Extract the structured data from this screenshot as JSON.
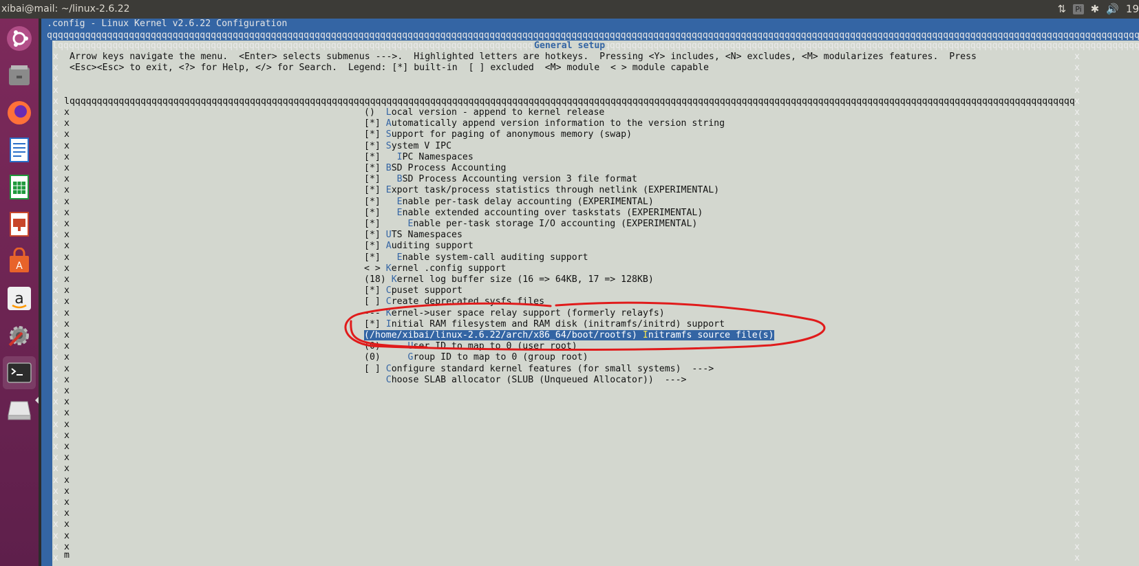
{
  "topbar": {
    "window_title": "xibai@mail: ~/linux-2.6.22",
    "indicators": [
      "⇅",
      "Pi",
      "✱",
      "🔊",
      "19"
    ]
  },
  "launcher": {
    "apps": [
      {
        "name": "ubuntu-dash-icon",
        "color": "#e95420"
      },
      {
        "name": "files-icon",
        "color": "#8a8a8a"
      },
      {
        "name": "firefox-icon",
        "color": "#ff7139"
      },
      {
        "name": "writer-icon",
        "color": "#2a6fc9"
      },
      {
        "name": "calc-icon",
        "color": "#1f9a3c"
      },
      {
        "name": "impress-icon",
        "color": "#c8462a"
      },
      {
        "name": "software-center-icon",
        "color": "#e8632a"
      },
      {
        "name": "amazon-icon",
        "color": "#333333"
      },
      {
        "name": "system-settings-icon",
        "color": "#777777"
      },
      {
        "name": "terminal-icon",
        "color": "#2c2c2c"
      },
      {
        "name": "drive-icon",
        "color": "#cfcfcf"
      }
    ]
  },
  "terminal": {
    "title_line": ".config - Linux Kernel v2.6.22 Configuration",
    "top_border": "qqqqqqqqqqqqqqqqqqqqqqqqqqqqqqqqqqqqqqqqqqqqqqqqqqqqqqqqqqqqqqqqqqqqqqqqqqqqqqqqqqqqqqqqqqqqqqqqqqqqqqqqqqqqqqqqqqqqqqqqqqqqqqqqqqqqqqqqqqqqqqqqqqqqqqqqqqqqqqqqqqqqqqqqqqqqqqqqqqqqqqqqqqqqqqqqqqqqqqqqqq"
  },
  "dialog": {
    "title": "General setup",
    "top_border": "lqqqqqqqqqqqqqqqqqqqqqqqqqqqqqqqqqqqqqqqqqqqqqqqqqqqqqqqqqqqqqqqqqqqqqqqqqqqqqqqqqqqqqqqqqqqqqqqqqqqqqqqqqqqqqqqqqqqqqqqqqqqqqqqqqqqqqqqqqqqqqqqqqqqqqqqqqqqqqqqqqqqqqqqqqqqqqqqqqqqqqqqqqqqqqqqqqqqqqqqqq",
    "help_line1": "Arrow keys navigate the menu.  <Enter> selects submenus --->.  Highlighted letters are hotkeys.  Pressing <Y> includes, <N> excludes, <M> modularizes features.  Press",
    "help_line2": "<Esc><Esc> to exit, <?> for Help, </> for Search.  Legend: [*] built-in  [ ] excluded  <M> module  < > module capable",
    "menu_border": "lqqqqqqqqqqqqqqqqqqqqqqqqqqqqqqqqqqqqqqqqqqqqqqqqqqqqqqqqqqqqqqqqqqqqqqqqqqqqqqqqqqqqqqqqqqqqqqqqqqqqqqqqqqqqqqqqqqqqqqqqqqqqqqqqqqqqqqqqqqqqqqqqqqqqqqqqqqqqqqqqqqqqqqqqqqqqqqqqqqqqqqqqqqqqqqqqqqqqqqqqqqqqqqqqqqqqqqqqqqqqqqqqqqqqqqqqqq",
    "border_char": "x",
    "bottom_mark": "m",
    "items": [
      {
        "prefix": "()  ",
        "hotkey": "L",
        "rest": "ocal version - append to kernel release"
      },
      {
        "prefix": "[*] ",
        "hotkey": "A",
        "rest": "utomatically append version information to the version string"
      },
      {
        "prefix": "[*] ",
        "hotkey": "S",
        "rest": "upport for paging of anonymous memory (swap)"
      },
      {
        "prefix": "[*] ",
        "hotkey": "S",
        "rest": "ystem V IPC"
      },
      {
        "prefix": "[*]   ",
        "hotkey": "I",
        "rest": "PC Namespaces"
      },
      {
        "prefix": "[*] ",
        "hotkey": "B",
        "rest": "SD Process Accounting"
      },
      {
        "prefix": "[*]   ",
        "hotkey": "B",
        "rest": "SD Process Accounting version 3 file format"
      },
      {
        "prefix": "[*] ",
        "hotkey": "E",
        "rest": "xport task/process statistics through netlink (EXPERIMENTAL)"
      },
      {
        "prefix": "[*]   ",
        "hotkey": "E",
        "rest": "nable per-task delay accounting (EXPERIMENTAL)"
      },
      {
        "prefix": "[*]   ",
        "hotkey": "E",
        "rest": "nable extended accounting over taskstats (EXPERIMENTAL)"
      },
      {
        "prefix": "[*]     ",
        "hotkey": "E",
        "rest": "nable per-task storage I/O accounting (EXPERIMENTAL)"
      },
      {
        "prefix": "[*] ",
        "hotkey": "U",
        "rest": "TS Namespaces"
      },
      {
        "prefix": "[*] ",
        "hotkey": "A",
        "rest": "uditing support"
      },
      {
        "prefix": "[*]   ",
        "hotkey": "E",
        "rest": "nable system-call auditing support"
      },
      {
        "prefix": "< > ",
        "hotkey": "K",
        "rest": "ernel .config support"
      },
      {
        "prefix": "(18) ",
        "hotkey": "K",
        "rest": "ernel log buffer size (16 => 64KB, 17 => 128KB)"
      },
      {
        "prefix": "[*] ",
        "hotkey": "C",
        "rest": "puset support"
      },
      {
        "prefix": "[ ] ",
        "hotkey": "C",
        "rest": "reate deprecated sysfs files"
      },
      {
        "prefix": "--- ",
        "hotkey": "K",
        "rest": "ernel->user space relay support (formerly relayfs)"
      },
      {
        "prefix": "[*] ",
        "hotkey": "I",
        "rest": "nitial RAM filesystem and RAM disk (initramfs/initrd) support"
      },
      {
        "prefix": "(/home/xibai/linux-2.6.22/arch/x86_64/boot/rootfs) ",
        "hotkey": "I",
        "rest": "nitramfs source file(s)",
        "selected": true
      },
      {
        "prefix": "(0)     ",
        "hotkey": "U",
        "rest": "ser ID to map to 0 (user root)"
      },
      {
        "prefix": "(0)     ",
        "hotkey": "G",
        "rest": "roup ID to map to 0 (group root)"
      },
      {
        "prefix": "[ ] ",
        "hotkey": "C",
        "rest": "onfigure standard kernel features (for small systems)  --->"
      },
      {
        "prefix": "    ",
        "hotkey": "C",
        "rest": "hoose SLAB allocator (SLUB (Unqueued Allocator))  --->"
      }
    ]
  },
  "annotation": {
    "color": "#e01b1b"
  }
}
